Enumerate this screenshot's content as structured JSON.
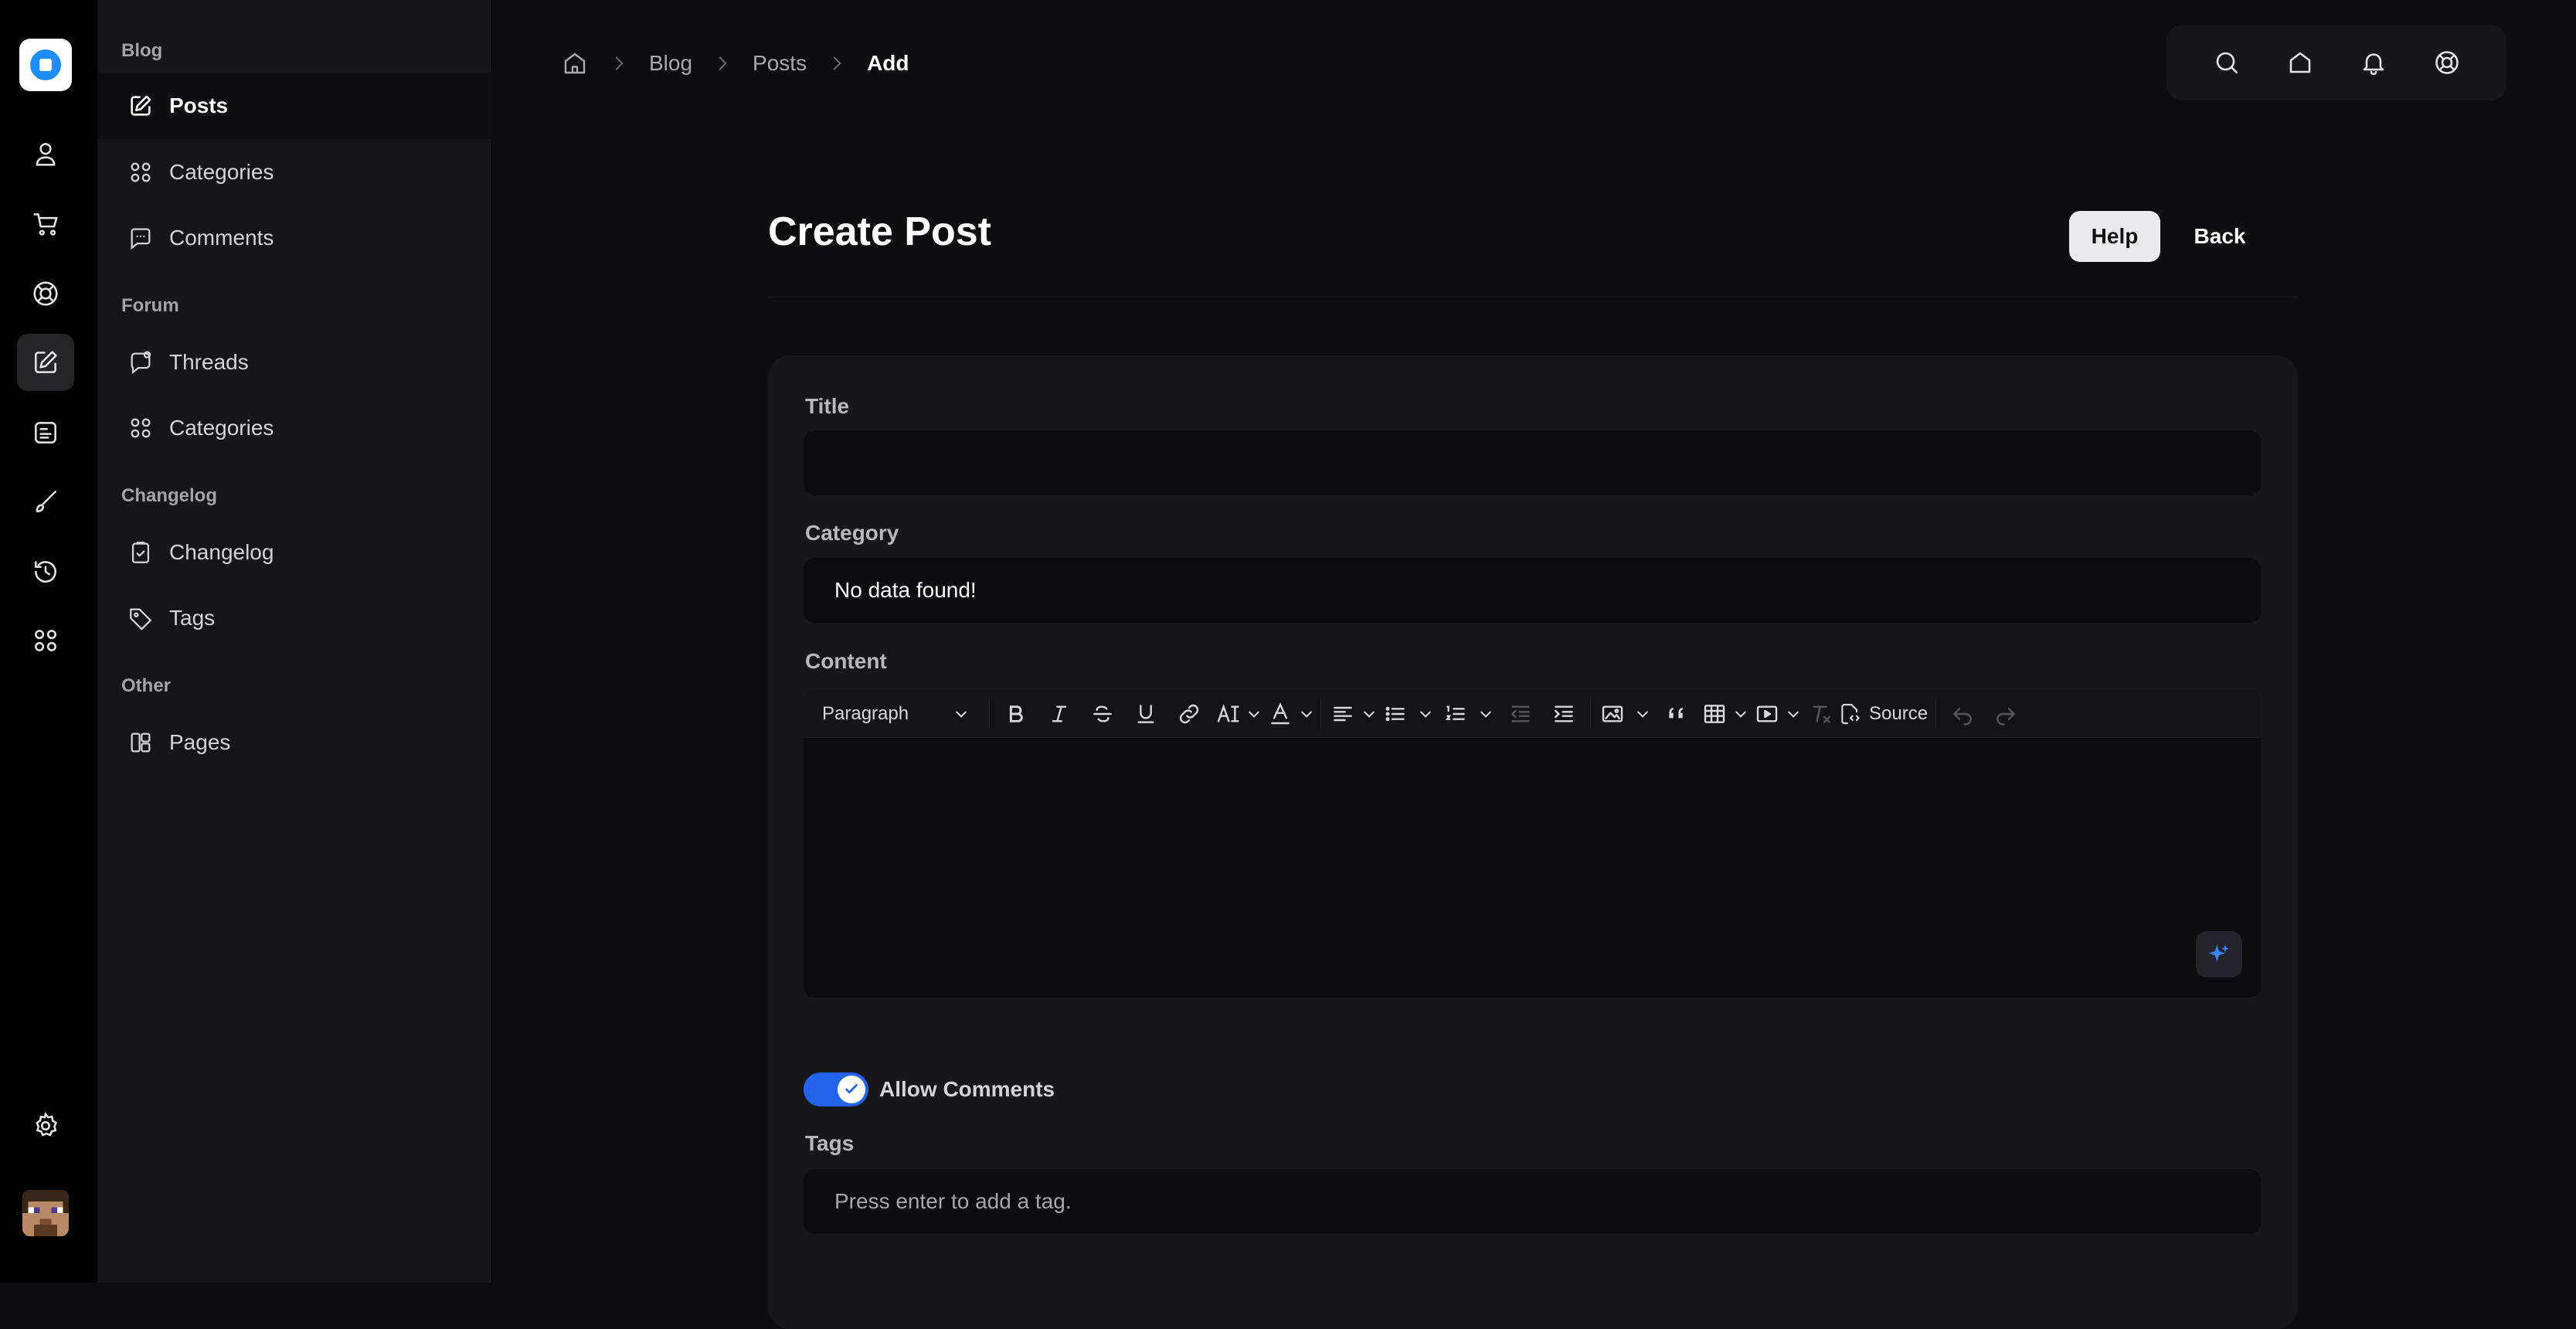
{
  "sidebar": {
    "sections": [
      {
        "title": "Blog",
        "items": [
          {
            "label": "Posts",
            "icon": "pencil-square-icon",
            "active": true
          },
          {
            "label": "Categories",
            "icon": "grid-icon"
          },
          {
            "label": "Comments",
            "icon": "chat-bubble-icon"
          }
        ]
      },
      {
        "title": "Forum",
        "items": [
          {
            "label": "Threads",
            "icon": "chat-thread-icon"
          },
          {
            "label": "Categories",
            "icon": "grid-icon"
          }
        ]
      },
      {
        "title": "Changelog",
        "items": [
          {
            "label": "Changelog",
            "icon": "clipboard-check-icon"
          },
          {
            "label": "Tags",
            "icon": "tag-icon"
          }
        ]
      },
      {
        "title": "Other",
        "items": [
          {
            "label": "Pages",
            "icon": "layout-icon"
          }
        ]
      }
    ]
  },
  "breadcrumb": {
    "items": [
      "Blog",
      "Posts"
    ],
    "current": "Add"
  },
  "page": {
    "title": "Create Post",
    "help_label": "Help",
    "back_label": "Back"
  },
  "form": {
    "title_label": "Title",
    "title_value": "",
    "category_label": "Category",
    "category_value": "No data found!",
    "content_label": "Content",
    "editor_block_format": "Paragraph",
    "editor_source_label": "Source",
    "allow_comments_label": "Allow Comments",
    "allow_comments_on": true,
    "tags_label": "Tags",
    "tags_placeholder": "Press enter to add a tag."
  },
  "colors": {
    "accent": "#2563eb",
    "background": "#0e0e10",
    "card": "#17171a",
    "input": "#0d0d0f"
  }
}
